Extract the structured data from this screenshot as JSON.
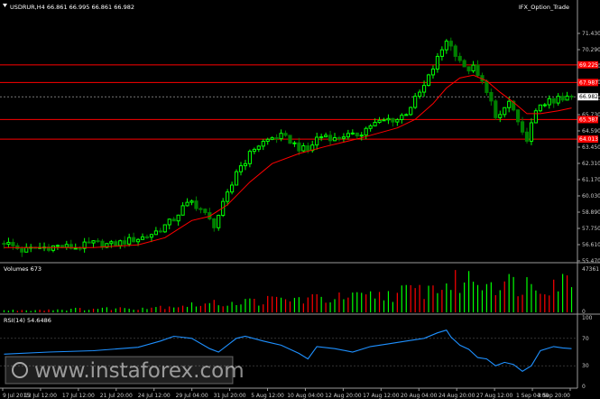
{
  "main": {
    "symbol_header": "USDRUR,H4  66.861 66.995 66.861 66.982",
    "indicator_name": "IFX_Option_Trade"
  },
  "volume_panel": {
    "label": "Volumes 673"
  },
  "rsi_panel": {
    "label": "RSI(14) 54.6486"
  },
  "watermark": {
    "text": "www.instaforex.com"
  },
  "colors": {
    "background": "#000000",
    "bull_candle": "#00ff00",
    "bear_candle": "#008000",
    "moving_average": "#ff0000",
    "level_line": "#ff0000",
    "rsi_line": "#1e90ff",
    "price_tag": "#ff0000",
    "current_price_tag": "#ffffff",
    "grid": "#3a3a3a"
  },
  "chart_data": [
    {
      "type": "candlestick",
      "symbol": "USDRUR",
      "timeframe": "H4",
      "ylim": [
        55.47,
        71.43
      ],
      "y_ticks": [
        "71.430",
        "70.290",
        "69.150",
        "68.010",
        "66.870",
        "65.730",
        "64.590",
        "63.450",
        "62.310",
        "61.170",
        "60.030",
        "58.890",
        "57.750",
        "56.610",
        "55.470"
      ],
      "x_ticks": [
        "9 Jul 2015",
        "13 Jul 12:00",
        "17 Jul 12:00",
        "21 Jul 20:00",
        "24 Jul 12:00",
        "29 Jul 04:00",
        "31 Jul 20:00",
        "5 Aug 12:00",
        "10 Aug 04:00",
        "12 Aug 20:00",
        "17 Aug 12:00",
        "20 Aug 04:00",
        "24 Aug 20:00",
        "27 Aug 12:00",
        "1 Sep 04:00",
        "3 Sep 20:00"
      ],
      "levels": [
        {
          "value": 69.225,
          "label": "69.225"
        },
        {
          "value": 67.987,
          "label": "67.987"
        },
        {
          "value": 65.387,
          "label": "65.387"
        },
        {
          "value": 64.013,
          "label": "64.013"
        }
      ],
      "current_price": {
        "value": 66.982,
        "label": "66.982"
      },
      "close_path": [
        {
          "x": 0,
          "y": 56.8
        },
        {
          "x": 4,
          "y": 56.2
        },
        {
          "x": 8,
          "y": 56.4
        },
        {
          "x": 12,
          "y": 56.5
        },
        {
          "x": 16,
          "y": 56.4
        },
        {
          "x": 20,
          "y": 56.7
        },
        {
          "x": 24,
          "y": 56.6
        },
        {
          "x": 28,
          "y": 56.9
        },
        {
          "x": 32,
          "y": 57.2
        },
        {
          "x": 35,
          "y": 57.7
        },
        {
          "x": 38,
          "y": 58.4
        },
        {
          "x": 40,
          "y": 59.2
        },
        {
          "x": 42,
          "y": 59.6
        },
        {
          "x": 44,
          "y": 59.1
        },
        {
          "x": 46,
          "y": 58.3
        },
        {
          "x": 47,
          "y": 58.0
        },
        {
          "x": 49,
          "y": 59.4
        },
        {
          "x": 51,
          "y": 60.8
        },
        {
          "x": 52,
          "y": 61.8
        },
        {
          "x": 54,
          "y": 62.5
        },
        {
          "x": 56,
          "y": 63.4
        },
        {
          "x": 58,
          "y": 63.8
        },
        {
          "x": 60,
          "y": 64.1
        },
        {
          "x": 62,
          "y": 64.2
        },
        {
          "x": 64,
          "y": 63.9
        },
        {
          "x": 66,
          "y": 63.4
        },
        {
          "x": 68,
          "y": 63.2
        },
        {
          "x": 70,
          "y": 64.1
        },
        {
          "x": 72,
          "y": 64.3
        },
        {
          "x": 74,
          "y": 64.0
        },
        {
          "x": 76,
          "y": 64.3
        },
        {
          "x": 78,
          "y": 64.2
        },
        {
          "x": 80,
          "y": 64.5
        },
        {
          "x": 82,
          "y": 65.0
        },
        {
          "x": 84,
          "y": 65.2
        },
        {
          "x": 86,
          "y": 65.4
        },
        {
          "x": 88,
          "y": 65.4
        },
        {
          "x": 90,
          "y": 65.9
        },
        {
          "x": 92,
          "y": 66.8
        },
        {
          "x": 94,
          "y": 67.7
        },
        {
          "x": 96,
          "y": 69.0
        },
        {
          "x": 98,
          "y": 70.3
        },
        {
          "x": 99,
          "y": 71.0
        },
        {
          "x": 100,
          "y": 70.5
        },
        {
          "x": 102,
          "y": 69.6
        },
        {
          "x": 103,
          "y": 68.9
        },
        {
          "x": 105,
          "y": 69.0
        },
        {
          "x": 106,
          "y": 68.4
        },
        {
          "x": 108,
          "y": 67.5
        },
        {
          "x": 109,
          "y": 66.6
        },
        {
          "x": 110,
          "y": 65.3
        },
        {
          "x": 111,
          "y": 65.7
        },
        {
          "x": 112,
          "y": 66.2
        },
        {
          "x": 113,
          "y": 66.6
        },
        {
          "x": 114,
          "y": 66.0
        },
        {
          "x": 115,
          "y": 65.0
        },
        {
          "x": 116,
          "y": 64.3
        },
        {
          "x": 117,
          "y": 64.1
        },
        {
          "x": 118,
          "y": 65.0
        },
        {
          "x": 119,
          "y": 65.8
        },
        {
          "x": 120,
          "y": 66.5
        },
        {
          "x": 121,
          "y": 66.6
        },
        {
          "x": 122,
          "y": 66.6
        },
        {
          "x": 123,
          "y": 66.5
        },
        {
          "x": 124,
          "y": 66.9
        },
        {
          "x": 125,
          "y": 66.7
        },
        {
          "x": 126,
          "y": 66.9
        },
        {
          "x": 127,
          "y": 66.98
        }
      ],
      "ma_path": [
        {
          "x": 0,
          "y": 56.4
        },
        {
          "x": 20,
          "y": 56.4
        },
        {
          "x": 30,
          "y": 56.6
        },
        {
          "x": 36,
          "y": 57.1
        },
        {
          "x": 42,
          "y": 58.3
        },
        {
          "x": 46,
          "y": 58.6
        },
        {
          "x": 50,
          "y": 59.4
        },
        {
          "x": 55,
          "y": 61.0
        },
        {
          "x": 60,
          "y": 62.3
        },
        {
          "x": 66,
          "y": 63.0
        },
        {
          "x": 72,
          "y": 63.5
        },
        {
          "x": 80,
          "y": 64.1
        },
        {
          "x": 88,
          "y": 64.8
        },
        {
          "x": 92,
          "y": 65.4
        },
        {
          "x": 96,
          "y": 66.5
        },
        {
          "x": 99,
          "y": 67.6
        },
        {
          "x": 102,
          "y": 68.3
        },
        {
          "x": 105,
          "y": 68.5
        },
        {
          "x": 108,
          "y": 68.1
        },
        {
          "x": 111,
          "y": 67.3
        },
        {
          "x": 114,
          "y": 66.6
        },
        {
          "x": 117,
          "y": 65.8
        },
        {
          "x": 120,
          "y": 65.8
        },
        {
          "x": 124,
          "y": 66.0
        },
        {
          "x": 127,
          "y": 66.2
        }
      ]
    },
    {
      "type": "bar",
      "name": "Volumes",
      "ylim": [
        0,
        47361
      ],
      "y_ticks": [
        "47361",
        "0"
      ],
      "profile": [
        {
          "x": 0,
          "y": 0.05
        },
        {
          "x": 30,
          "y": 0.12
        },
        {
          "x": 45,
          "y": 0.22
        },
        {
          "x": 60,
          "y": 0.33
        },
        {
          "x": 80,
          "y": 0.4
        },
        {
          "x": 95,
          "y": 0.62
        },
        {
          "x": 105,
          "y": 0.9
        },
        {
          "x": 115,
          "y": 0.75
        },
        {
          "x": 127,
          "y": 0.85
        }
      ]
    },
    {
      "type": "line",
      "name": "RSI(14)",
      "ylim": [
        0,
        100
      ],
      "y_ticks": [
        "100",
        "70",
        "30",
        "0"
      ],
      "values": [
        {
          "x": 0,
          "y": 47
        },
        {
          "x": 10,
          "y": 50
        },
        {
          "x": 20,
          "y": 52
        },
        {
          "x": 30,
          "y": 57
        },
        {
          "x": 35,
          "y": 66
        },
        {
          "x": 38,
          "y": 73
        },
        {
          "x": 42,
          "y": 70
        },
        {
          "x": 46,
          "y": 55
        },
        {
          "x": 48,
          "y": 50
        },
        {
          "x": 52,
          "y": 70
        },
        {
          "x": 54,
          "y": 73
        },
        {
          "x": 58,
          "y": 66
        },
        {
          "x": 62,
          "y": 60
        },
        {
          "x": 66,
          "y": 48
        },
        {
          "x": 68,
          "y": 40
        },
        {
          "x": 70,
          "y": 58
        },
        {
          "x": 74,
          "y": 55
        },
        {
          "x": 78,
          "y": 50
        },
        {
          "x": 82,
          "y": 58
        },
        {
          "x": 86,
          "y": 62
        },
        {
          "x": 90,
          "y": 66
        },
        {
          "x": 94,
          "y": 70
        },
        {
          "x": 97,
          "y": 78
        },
        {
          "x": 99,
          "y": 82
        },
        {
          "x": 100,
          "y": 72
        },
        {
          "x": 102,
          "y": 60
        },
        {
          "x": 104,
          "y": 54
        },
        {
          "x": 106,
          "y": 42
        },
        {
          "x": 108,
          "y": 40
        },
        {
          "x": 110,
          "y": 30
        },
        {
          "x": 112,
          "y": 35
        },
        {
          "x": 114,
          "y": 32
        },
        {
          "x": 116,
          "y": 22
        },
        {
          "x": 118,
          "y": 30
        },
        {
          "x": 120,
          "y": 52
        },
        {
          "x": 123,
          "y": 58
        },
        {
          "x": 125,
          "y": 56
        },
        {
          "x": 127,
          "y": 55
        }
      ]
    }
  ]
}
